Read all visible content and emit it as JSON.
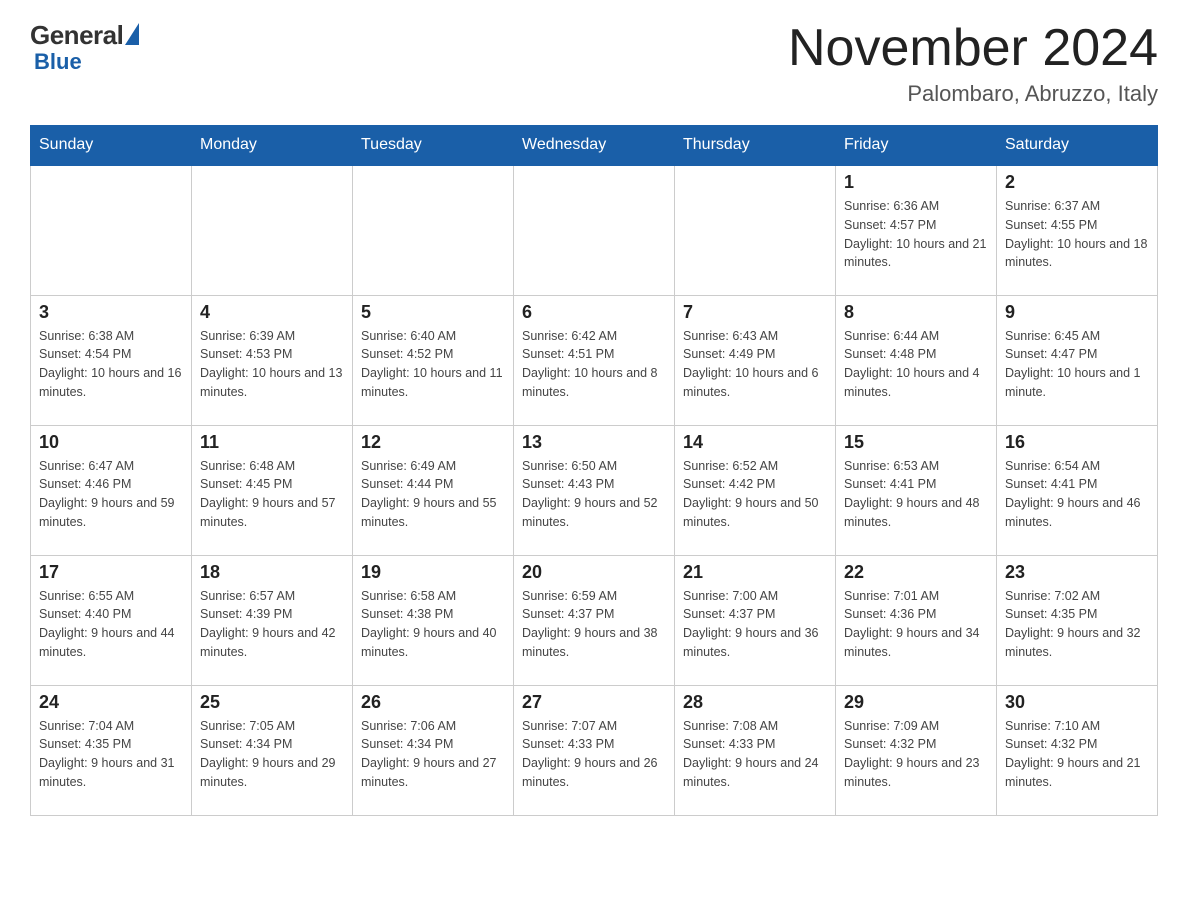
{
  "header": {
    "logo_general": "General",
    "logo_blue": "Blue",
    "month_title": "November 2024",
    "location": "Palombaro, Abruzzo, Italy"
  },
  "days_of_week": [
    "Sunday",
    "Monday",
    "Tuesday",
    "Wednesday",
    "Thursday",
    "Friday",
    "Saturday"
  ],
  "weeks": [
    [
      {
        "day": "",
        "info": ""
      },
      {
        "day": "",
        "info": ""
      },
      {
        "day": "",
        "info": ""
      },
      {
        "day": "",
        "info": ""
      },
      {
        "day": "",
        "info": ""
      },
      {
        "day": "1",
        "info": "Sunrise: 6:36 AM\nSunset: 4:57 PM\nDaylight: 10 hours and 21 minutes."
      },
      {
        "day": "2",
        "info": "Sunrise: 6:37 AM\nSunset: 4:55 PM\nDaylight: 10 hours and 18 minutes."
      }
    ],
    [
      {
        "day": "3",
        "info": "Sunrise: 6:38 AM\nSunset: 4:54 PM\nDaylight: 10 hours and 16 minutes."
      },
      {
        "day": "4",
        "info": "Sunrise: 6:39 AM\nSunset: 4:53 PM\nDaylight: 10 hours and 13 minutes."
      },
      {
        "day": "5",
        "info": "Sunrise: 6:40 AM\nSunset: 4:52 PM\nDaylight: 10 hours and 11 minutes."
      },
      {
        "day": "6",
        "info": "Sunrise: 6:42 AM\nSunset: 4:51 PM\nDaylight: 10 hours and 8 minutes."
      },
      {
        "day": "7",
        "info": "Sunrise: 6:43 AM\nSunset: 4:49 PM\nDaylight: 10 hours and 6 minutes."
      },
      {
        "day": "8",
        "info": "Sunrise: 6:44 AM\nSunset: 4:48 PM\nDaylight: 10 hours and 4 minutes."
      },
      {
        "day": "9",
        "info": "Sunrise: 6:45 AM\nSunset: 4:47 PM\nDaylight: 10 hours and 1 minute."
      }
    ],
    [
      {
        "day": "10",
        "info": "Sunrise: 6:47 AM\nSunset: 4:46 PM\nDaylight: 9 hours and 59 minutes."
      },
      {
        "day": "11",
        "info": "Sunrise: 6:48 AM\nSunset: 4:45 PM\nDaylight: 9 hours and 57 minutes."
      },
      {
        "day": "12",
        "info": "Sunrise: 6:49 AM\nSunset: 4:44 PM\nDaylight: 9 hours and 55 minutes."
      },
      {
        "day": "13",
        "info": "Sunrise: 6:50 AM\nSunset: 4:43 PM\nDaylight: 9 hours and 52 minutes."
      },
      {
        "day": "14",
        "info": "Sunrise: 6:52 AM\nSunset: 4:42 PM\nDaylight: 9 hours and 50 minutes."
      },
      {
        "day": "15",
        "info": "Sunrise: 6:53 AM\nSunset: 4:41 PM\nDaylight: 9 hours and 48 minutes."
      },
      {
        "day": "16",
        "info": "Sunrise: 6:54 AM\nSunset: 4:41 PM\nDaylight: 9 hours and 46 minutes."
      }
    ],
    [
      {
        "day": "17",
        "info": "Sunrise: 6:55 AM\nSunset: 4:40 PM\nDaylight: 9 hours and 44 minutes."
      },
      {
        "day": "18",
        "info": "Sunrise: 6:57 AM\nSunset: 4:39 PM\nDaylight: 9 hours and 42 minutes."
      },
      {
        "day": "19",
        "info": "Sunrise: 6:58 AM\nSunset: 4:38 PM\nDaylight: 9 hours and 40 minutes."
      },
      {
        "day": "20",
        "info": "Sunrise: 6:59 AM\nSunset: 4:37 PM\nDaylight: 9 hours and 38 minutes."
      },
      {
        "day": "21",
        "info": "Sunrise: 7:00 AM\nSunset: 4:37 PM\nDaylight: 9 hours and 36 minutes."
      },
      {
        "day": "22",
        "info": "Sunrise: 7:01 AM\nSunset: 4:36 PM\nDaylight: 9 hours and 34 minutes."
      },
      {
        "day": "23",
        "info": "Sunrise: 7:02 AM\nSunset: 4:35 PM\nDaylight: 9 hours and 32 minutes."
      }
    ],
    [
      {
        "day": "24",
        "info": "Sunrise: 7:04 AM\nSunset: 4:35 PM\nDaylight: 9 hours and 31 minutes."
      },
      {
        "day": "25",
        "info": "Sunrise: 7:05 AM\nSunset: 4:34 PM\nDaylight: 9 hours and 29 minutes."
      },
      {
        "day": "26",
        "info": "Sunrise: 7:06 AM\nSunset: 4:34 PM\nDaylight: 9 hours and 27 minutes."
      },
      {
        "day": "27",
        "info": "Sunrise: 7:07 AM\nSunset: 4:33 PM\nDaylight: 9 hours and 26 minutes."
      },
      {
        "day": "28",
        "info": "Sunrise: 7:08 AM\nSunset: 4:33 PM\nDaylight: 9 hours and 24 minutes."
      },
      {
        "day": "29",
        "info": "Sunrise: 7:09 AM\nSunset: 4:32 PM\nDaylight: 9 hours and 23 minutes."
      },
      {
        "day": "30",
        "info": "Sunrise: 7:10 AM\nSunset: 4:32 PM\nDaylight: 9 hours and 21 minutes."
      }
    ]
  ]
}
